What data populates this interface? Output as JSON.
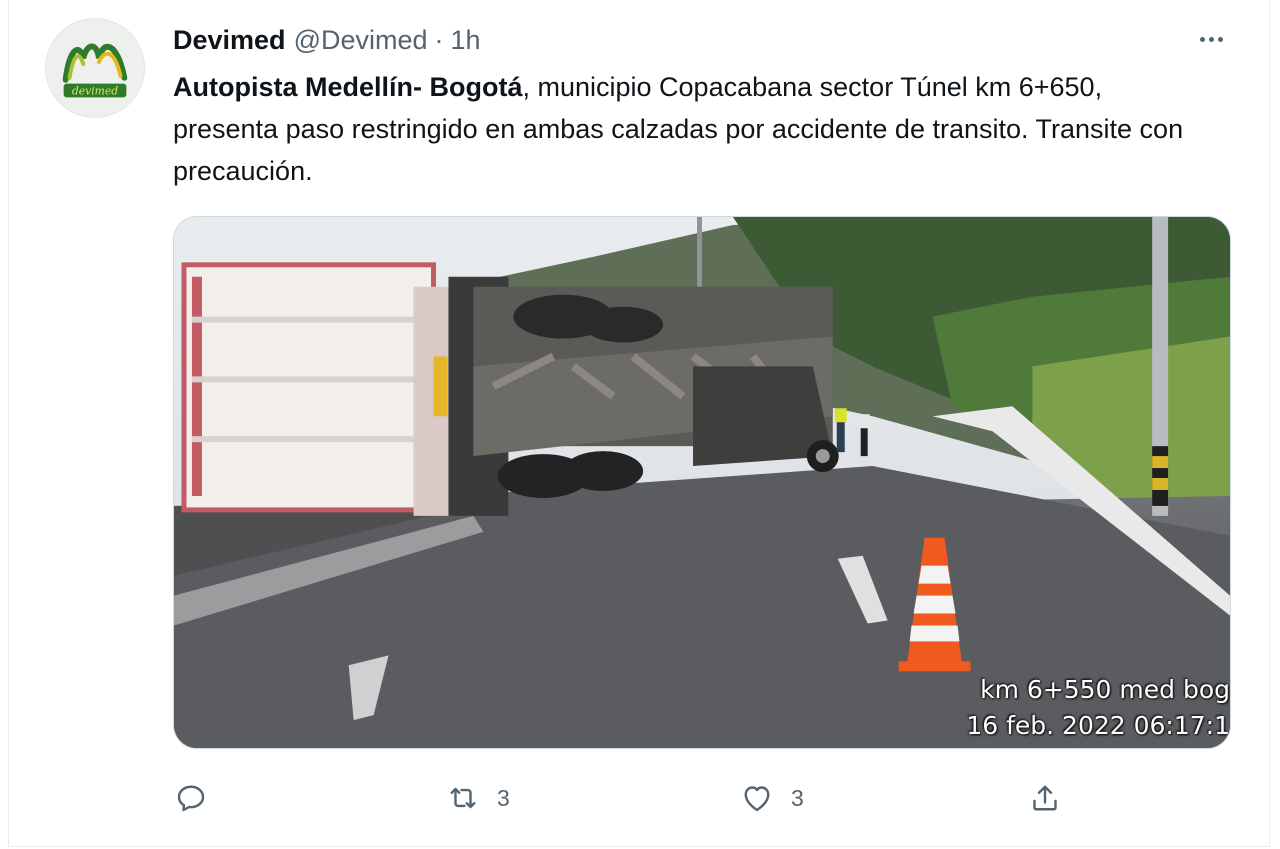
{
  "tweet": {
    "author": {
      "display_name": "Devimed",
      "handle": "@Devimed",
      "avatar_text": "devimed"
    },
    "separator": "·",
    "time": "1h",
    "text_bold": "Autopista Medellín- Bogotá",
    "text_rest": ", municipio Copacabana sector Túnel km 6+650, presenta paso restringido en ambas calzadas por accidente de transito. Transite con precaución.",
    "media": {
      "description_stamp_location": "km 6+550 med bog",
      "description_stamp_date": "16 feb. 2022 06:17:1"
    },
    "actions": {
      "reply_count": "",
      "retweet_count": "3",
      "like_count": "3"
    }
  },
  "icons": {
    "more": "more-horizontal-icon",
    "reply": "reply-icon",
    "retweet": "retweet-icon",
    "like": "heart-icon",
    "share": "share-icon"
  },
  "colors": {
    "secondary_text": "#536471",
    "primary_text": "#0f1419",
    "border": "#cfd9de"
  }
}
